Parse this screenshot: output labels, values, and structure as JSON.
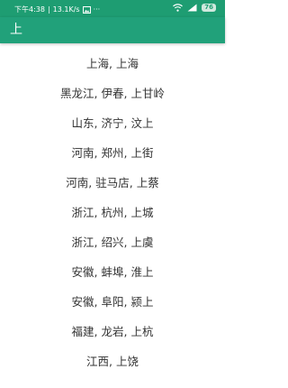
{
  "status_bar": {
    "time": "下午4:38",
    "separator": "|",
    "speed": "13.1K/s",
    "more": "···",
    "battery": "76",
    "icons": [
      "image-icon",
      "wifi-icon",
      "signal-icon",
      "battery-icon"
    ],
    "background": "#1e9d72"
  },
  "app_bar": {
    "title": "上",
    "background": "#21a17a"
  },
  "list": {
    "items": [
      "上海, 上海",
      "黑龙江, 伊春, 上甘岭",
      "山东, 济宁, 汶上",
      "河南, 郑州, 上街",
      "河南, 驻马店, 上蔡",
      "浙江, 杭州, 上城",
      "浙江, 绍兴, 上虞",
      "安徽, 蚌埠, 淮上",
      "安徽, 阜阳, 颍上",
      "福建, 龙岩, 上杭",
      "江西, 上饶"
    ]
  }
}
